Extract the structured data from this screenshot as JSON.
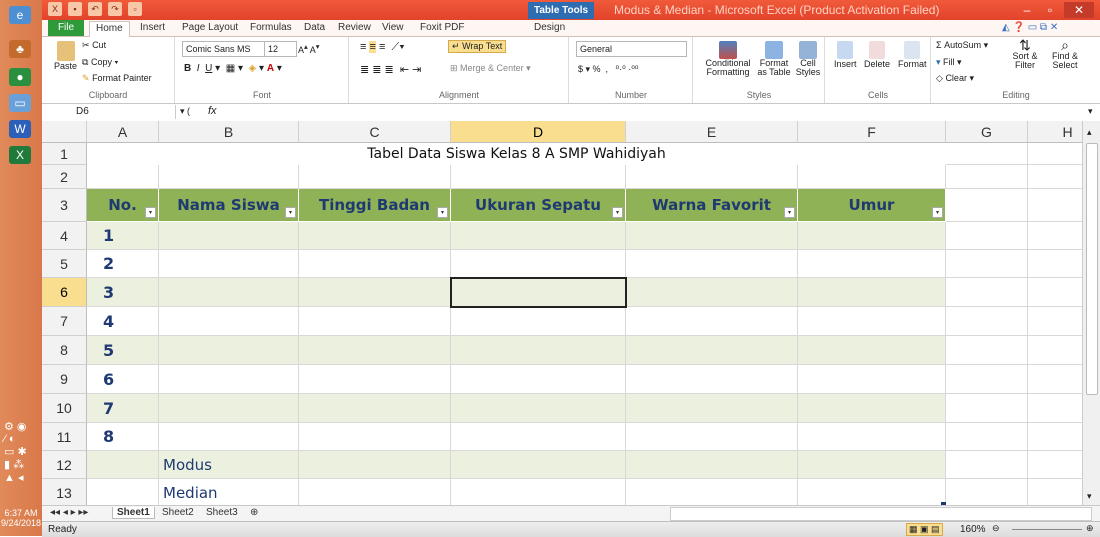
{
  "window": {
    "title": "Modus & Median - Microsoft Excel (Product Activation Failed)",
    "table_tools": "Table Tools"
  },
  "ribbon_tabs": [
    "File",
    "Home",
    "Insert",
    "Page Layout",
    "Formulas",
    "Data",
    "Review",
    "View",
    "Foxit PDF",
    "Design"
  ],
  "ribbon": {
    "clipboard": {
      "label": "Clipboard",
      "paste": "Paste",
      "cut": "Cut",
      "copy": "Copy",
      "format_painter": "Format Painter"
    },
    "font": {
      "label": "Font",
      "name": "Comic Sans MS",
      "size": "12"
    },
    "alignment": {
      "label": "Alignment",
      "wrap_text": "Wrap Text",
      "merge_center": "Merge & Center"
    },
    "number": {
      "label": "Number",
      "format": "General"
    },
    "styles": {
      "label": "Styles",
      "conditional": "Conditional Formatting",
      "format_table": "Format as Table",
      "cell_styles": "Cell Styles"
    },
    "cells": {
      "label": "Cells",
      "insert": "Insert",
      "delete": "Delete",
      "format": "Format"
    },
    "editing": {
      "label": "Editing",
      "autosum": "AutoSum",
      "fill": "Fill",
      "clear": "Clear",
      "sort_filter": "Sort & Filter",
      "find_select": "Find & Select"
    }
  },
  "formula_bar": {
    "name_box": "D6",
    "fx": "fx",
    "content": ""
  },
  "columns": [
    "A",
    "B",
    "C",
    "D",
    "E",
    "F",
    "G",
    "H"
  ],
  "rows": [
    "1",
    "2",
    "3",
    "4",
    "5",
    "6",
    "7",
    "8",
    "9",
    "10",
    "11",
    "12",
    "13"
  ],
  "active_cell": {
    "column": "D",
    "row": "6"
  },
  "sheet": {
    "title": "Tabel Data Siswa Kelas 8 A SMP Wahidiyah",
    "headers": [
      "No.",
      "Nama Siswa",
      "Tinggi Badan",
      "Ukuran Sepatu",
      "Warna Favorit",
      "Umur"
    ],
    "numbers": [
      "1",
      "2",
      "3",
      "4",
      "5",
      "6",
      "7",
      "8"
    ],
    "modus_label": "Modus",
    "median_label": "Median"
  },
  "sheet_tabs": [
    "Sheet1",
    "Sheet2",
    "Sheet3"
  ],
  "status": {
    "ready": "Ready",
    "zoom": "160%"
  },
  "clock": {
    "time": "6:37 AM",
    "date": "9/24/2018"
  },
  "colors": {
    "header_fill": "#8eb255",
    "band_fill": "#ebf1de",
    "text_blue": "#1f3a72",
    "title_bar": "#e2432b"
  }
}
